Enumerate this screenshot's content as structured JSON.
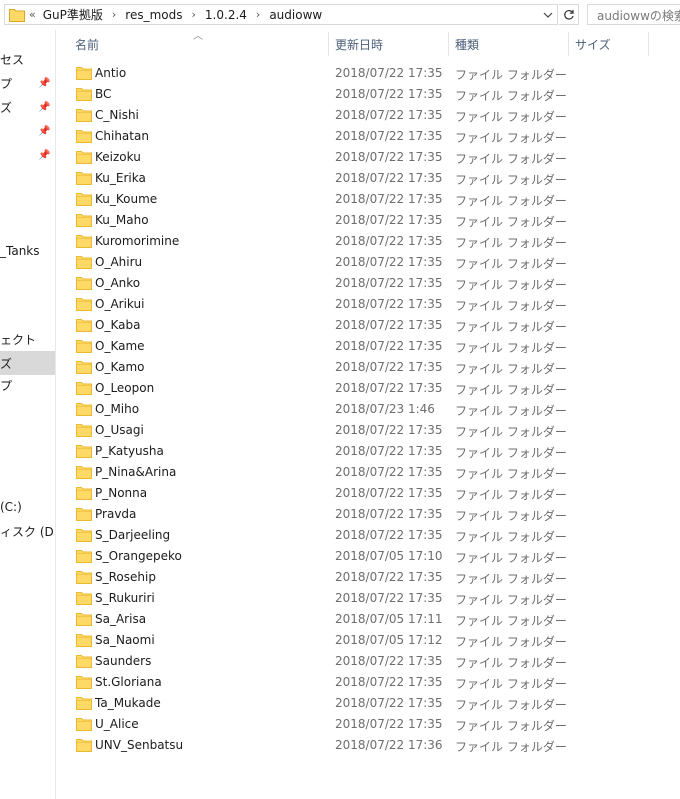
{
  "address_bar": {
    "overflow_label": "«",
    "crumbs": [
      "GuP準拠版",
      "res_mods",
      "1.0.2.4",
      "audioww"
    ],
    "separator": "›",
    "search_placeholder": "audiowwの検索"
  },
  "nav": {
    "items": [
      {
        "label": "セス"
      },
      {
        "label": "プ"
      },
      {
        "label": "ズ"
      },
      {
        "label": ""
      },
      {
        "label": ""
      },
      {
        "label": "_Tanks"
      },
      {
        "label": "ェクト"
      },
      {
        "label": "ズ"
      },
      {
        "label": "プ"
      },
      {
        "label": "(C:)"
      },
      {
        "label": "ィスク (D:)"
      }
    ]
  },
  "columns": {
    "name": "名前",
    "date": "更新日時",
    "type": "種類",
    "size": "サイズ"
  },
  "files": [
    {
      "name": "Antio",
      "date": "2018/07/22 17:35",
      "type": "ファイル フォルダー"
    },
    {
      "name": "BC",
      "date": "2018/07/22 17:35",
      "type": "ファイル フォルダー"
    },
    {
      "name": "C_Nishi",
      "date": "2018/07/22 17:35",
      "type": "ファイル フォルダー"
    },
    {
      "name": "Chihatan",
      "date": "2018/07/22 17:35",
      "type": "ファイル フォルダー"
    },
    {
      "name": "Keizoku",
      "date": "2018/07/22 17:35",
      "type": "ファイル フォルダー"
    },
    {
      "name": "Ku_Erika",
      "date": "2018/07/22 17:35",
      "type": "ファイル フォルダー"
    },
    {
      "name": "Ku_Koume",
      "date": "2018/07/22 17:35",
      "type": "ファイル フォルダー"
    },
    {
      "name": "Ku_Maho",
      "date": "2018/07/22 17:35",
      "type": "ファイル フォルダー"
    },
    {
      "name": "Kuromorimine",
      "date": "2018/07/22 17:35",
      "type": "ファイル フォルダー"
    },
    {
      "name": "O_Ahiru",
      "date": "2018/07/22 17:35",
      "type": "ファイル フォルダー"
    },
    {
      "name": "O_Anko",
      "date": "2018/07/22 17:35",
      "type": "ファイル フォルダー"
    },
    {
      "name": "O_Arikui",
      "date": "2018/07/22 17:35",
      "type": "ファイル フォルダー"
    },
    {
      "name": "O_Kaba",
      "date": "2018/07/22 17:35",
      "type": "ファイル フォルダー"
    },
    {
      "name": "O_Kame",
      "date": "2018/07/22 17:35",
      "type": "ファイル フォルダー"
    },
    {
      "name": "O_Kamo",
      "date": "2018/07/22 17:35",
      "type": "ファイル フォルダー"
    },
    {
      "name": "O_Leopon",
      "date": "2018/07/22 17:35",
      "type": "ファイル フォルダー"
    },
    {
      "name": "O_Miho",
      "date": "2018/07/23 1:46",
      "type": "ファイル フォルダー"
    },
    {
      "name": "O_Usagi",
      "date": "2018/07/22 17:35",
      "type": "ファイル フォルダー"
    },
    {
      "name": "P_Katyusha",
      "date": "2018/07/22 17:35",
      "type": "ファイル フォルダー"
    },
    {
      "name": "P_Nina&Arina",
      "date": "2018/07/22 17:35",
      "type": "ファイル フォルダー"
    },
    {
      "name": "P_Nonna",
      "date": "2018/07/22 17:35",
      "type": "ファイル フォルダー"
    },
    {
      "name": "Pravda",
      "date": "2018/07/22 17:35",
      "type": "ファイル フォルダー"
    },
    {
      "name": "S_Darjeeling",
      "date": "2018/07/22 17:35",
      "type": "ファイル フォルダー"
    },
    {
      "name": "S_Orangepeko",
      "date": "2018/07/05 17:10",
      "type": "ファイル フォルダー"
    },
    {
      "name": "S_Rosehip",
      "date": "2018/07/22 17:35",
      "type": "ファイル フォルダー"
    },
    {
      "name": "S_Rukuriri",
      "date": "2018/07/22 17:35",
      "type": "ファイル フォルダー"
    },
    {
      "name": "Sa_Arisa",
      "date": "2018/07/05 17:11",
      "type": "ファイル フォルダー"
    },
    {
      "name": "Sa_Naomi",
      "date": "2018/07/05 17:12",
      "type": "ファイル フォルダー"
    },
    {
      "name": "Saunders",
      "date": "2018/07/22 17:35",
      "type": "ファイル フォルダー"
    },
    {
      "name": "St.Gloriana",
      "date": "2018/07/22 17:35",
      "type": "ファイル フォルダー"
    },
    {
      "name": "Ta_Mukade",
      "date": "2018/07/22 17:35",
      "type": "ファイル フォルダー"
    },
    {
      "name": "U_Alice",
      "date": "2018/07/22 17:35",
      "type": "ファイル フォルダー"
    },
    {
      "name": "UNV_Senbatsu",
      "date": "2018/07/22 17:36",
      "type": "ファイル フォルダー"
    }
  ],
  "colors": {
    "folder": "#ffd966",
    "folder_dark": "#e8b932",
    "header_text": "#4c607a",
    "selected_nav": "#d9d9d9"
  }
}
